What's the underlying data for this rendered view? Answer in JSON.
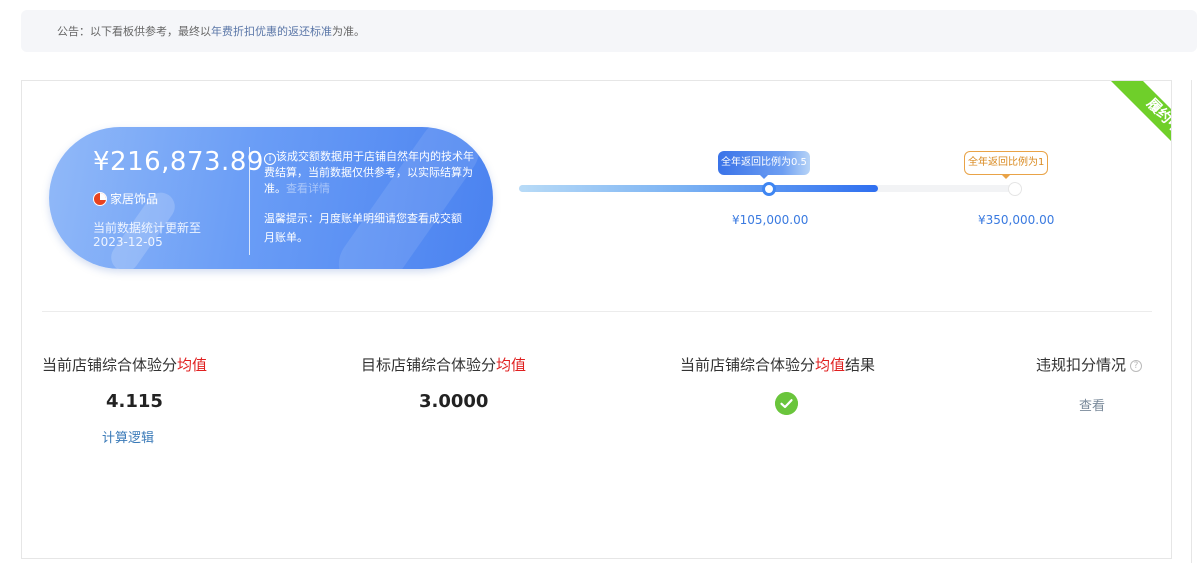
{
  "notice": {
    "prefix": "公告：以下看板供参考，最终以",
    "link": "年费折扣优惠的返还标准",
    "suffix": "为准。"
  },
  "status_ribbon": "履约中",
  "summary": {
    "amount": "¥216,873.89",
    "category": "家居饰品",
    "updated_label": "当前数据统计更新至",
    "updated_date": "2023-12-05",
    "info_icon": "i",
    "info_text": "该成交额数据用于店铺自然年内的技术年费结算，当前数据仅供参考，以实际结算为准。",
    "info_faded": "查看详情",
    "tip": "温馨提示：月度账单明细请您查看成交额月账单。"
  },
  "progress": {
    "current_fraction": 0.5,
    "milestones": [
      {
        "label": "全年返回比例为0.5",
        "value": "¥105,000.00"
      },
      {
        "label": "全年返回比例为1",
        "value": "¥350,000.00"
      }
    ]
  },
  "metrics": [
    {
      "title_main": "当前店铺综合体验分",
      "title_hl": "均值",
      "title_suffix": "",
      "value": "4.115",
      "link": "计算逻辑"
    },
    {
      "title_main": "目标店铺综合体验分",
      "title_hl": "均值",
      "title_suffix": "",
      "value": "3.0000"
    },
    {
      "title_main": "当前店铺综合体验分",
      "title_hl": "均值",
      "title_suffix": "结果",
      "status_icon": "check-circle-icon",
      "status_color": "#6ac53c"
    },
    {
      "title_main": "违规扣分情况",
      "help_icon": "?",
      "link": "查看"
    }
  ],
  "colors": {
    "accent": "#3f86f2",
    "highlight_red": "#e02020",
    "ribbon_green": "#6fcf2a",
    "tag_orange": "#e9a347"
  }
}
